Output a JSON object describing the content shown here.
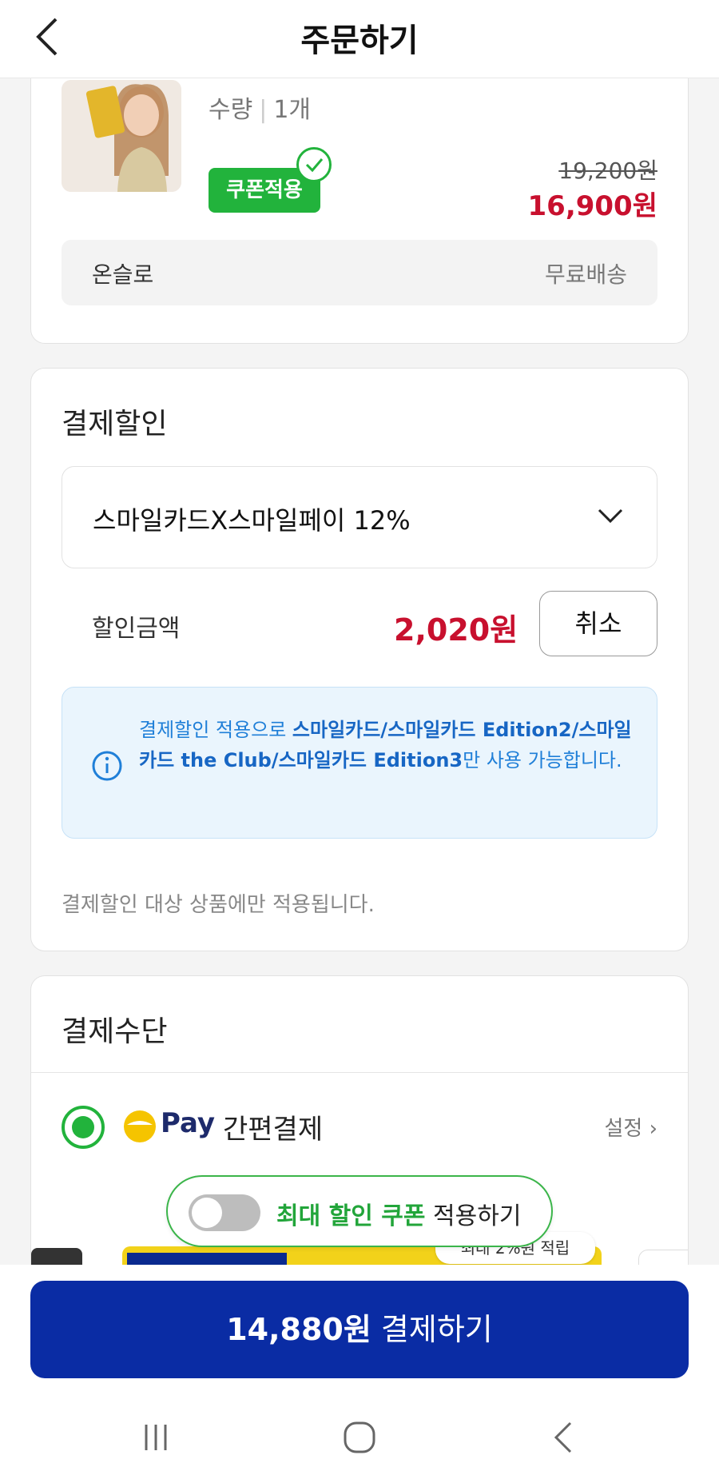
{
  "header": {
    "title": "주문하기"
  },
  "product": {
    "quantity_label": "수량",
    "quantity_value": "1개",
    "coupon_badge": "쿠폰적용",
    "original_price": "19,200원",
    "sale_price": "16,900원",
    "seller": "온슬로",
    "shipping": "무료배송"
  },
  "payment_discount": {
    "title": "결제할인",
    "selected_option": "스마일카드X스마일페이 12%",
    "discount_label": "할인금액",
    "discount_amount": "2,020원",
    "cancel_label": "취소",
    "info": {
      "prefix": "결제할인 적용으로 ",
      "cards": "스마일카드/스마일카드 Edition2/스마일카드 the Club/스마일카드 Edition3",
      "suffix": "만 사용 가능합니다."
    },
    "note": "결제할인 대상 상품에만 적용됩니다."
  },
  "payment_method": {
    "title": "결제수단",
    "pay_brand": "Pay",
    "pay_name": "간편결제",
    "setting_label": "설정 ›",
    "badge": "최대 2%원 적립"
  },
  "coupon_toggle": {
    "highlight": "최대 할인 쿠폰",
    "suffix": " 적용하기"
  },
  "checkout": {
    "amount": "14,880원",
    "label": " 결제하기"
  },
  "colors": {
    "accent_green": "#22b33c",
    "price_red": "#c8102e",
    "pay_button": "#0a2ca4",
    "info_blue": "#1f7fd8"
  }
}
